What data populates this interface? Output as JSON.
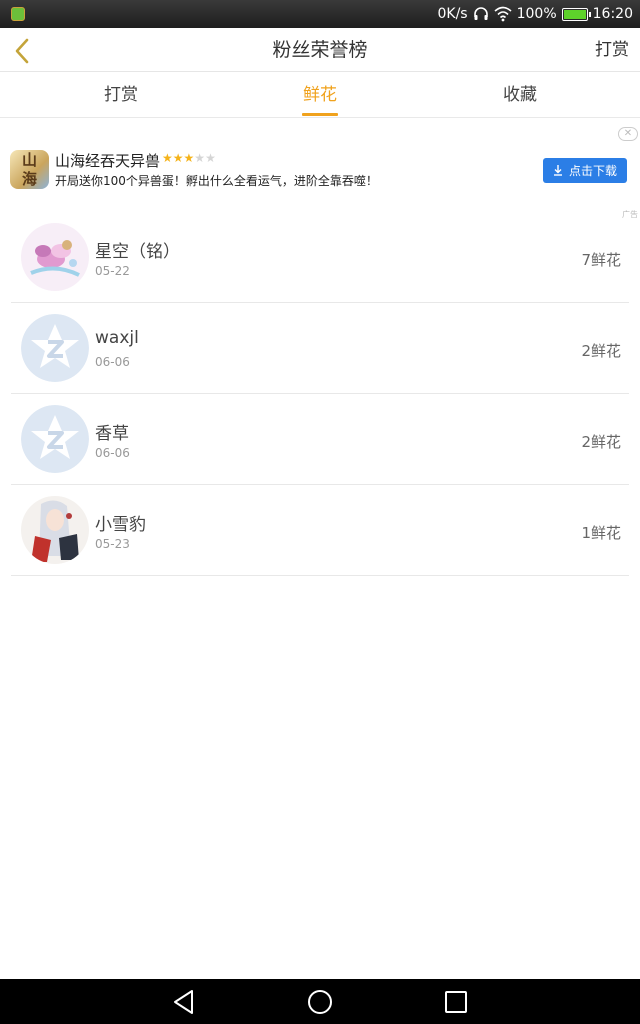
{
  "status_bar": {
    "network_speed": "0K/s",
    "battery_percent": "100%",
    "battery_level": 1.0,
    "time": "16:20",
    "icons": [
      "app-icon",
      "headphone-icon",
      "wifi-icon",
      "battery-icon"
    ]
  },
  "nav": {
    "title": "粉丝荣誉榜",
    "action": "打赏",
    "back_icon": "chevron-left-icon"
  },
  "tabs": [
    {
      "label": "打赏",
      "active": false
    },
    {
      "label": "鲜花",
      "active": true
    },
    {
      "label": "收藏",
      "active": false
    }
  ],
  "ad": {
    "icon_text": "山海",
    "title": "山海经吞天异兽",
    "rating": 3,
    "rating_max": 5,
    "description": "开局送你100个异兽蛋！孵出什么全看运气，进阶全靠吞噬！",
    "button_label": "点击下载",
    "badge": "广告"
  },
  "fans": [
    {
      "name": "星空（铭）",
      "date": "05-22",
      "count": "7鲜花",
      "avatar": "anime-flower-avatar"
    },
    {
      "name": "waxjl",
      "date": "06-06",
      "count": "2鲜花",
      "avatar": "default-star-avatar"
    },
    {
      "name": "香草",
      "date": "06-06",
      "count": "2鲜花",
      "avatar": "default-star-avatar"
    },
    {
      "name": "小雪豹",
      "date": "05-23",
      "count": "1鲜花",
      "avatar": "anime-girl-avatar"
    }
  ],
  "colors": {
    "accent": "#f0a21d",
    "ad_button": "#2b7ee6",
    "star_on": "#f5b31a",
    "default_avatar_bg": "#dde7f3"
  }
}
